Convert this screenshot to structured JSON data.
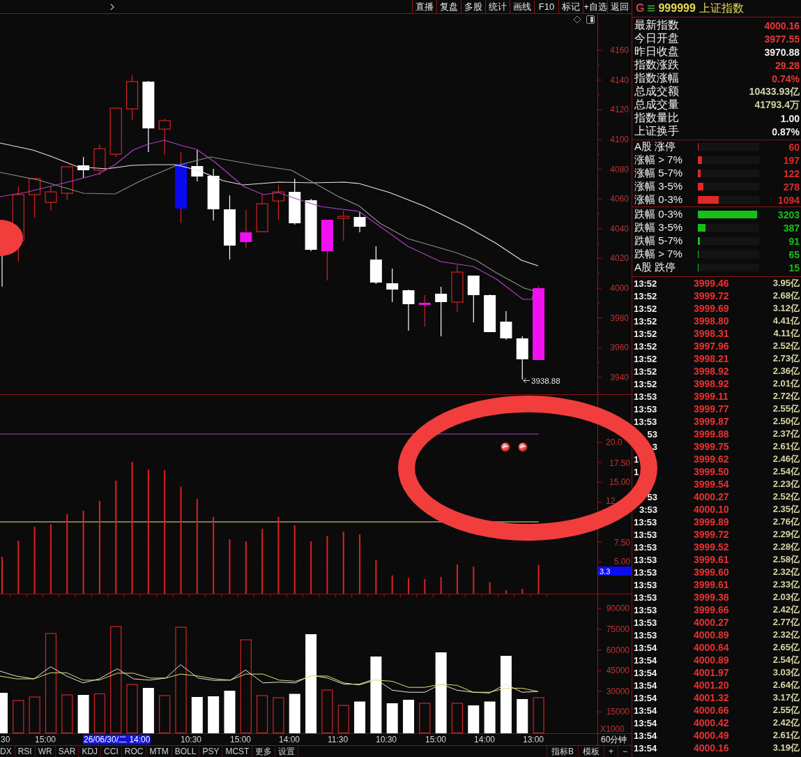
{
  "toolbar": {
    "buttons": [
      "直播",
      "复盘",
      "多股",
      "统计",
      "画线",
      "F10",
      "标记",
      "+自选",
      "返回"
    ]
  },
  "price_chart": {
    "axis_labels": [
      "4160",
      "4140",
      "4120",
      "4100",
      "4080",
      "4060",
      "4040",
      "4020",
      "4000",
      "3980",
      "3960",
      "3940"
    ],
    "low_label": "3938.88"
  },
  "indicator_chart": {
    "axis_labels": [
      {
        "text": "20.0",
        "right_hidden": true
      },
      {
        "text": "17.50"
      },
      {
        "text": "15.00"
      },
      {
        "text": "12",
        "right_hidden": true
      },
      {
        "text": "7.50"
      },
      {
        "text": "5.00"
      }
    ],
    "current_value": "3.3"
  },
  "volume_chart": {
    "axis_labels": [
      "90000",
      "75000",
      "60000",
      "45000",
      "30000",
      "15000"
    ],
    "unit": "X1000"
  },
  "time_axis": {
    "labels": [
      {
        "text": "30",
        "highlighted": false
      },
      {
        "text": "15:00",
        "highlighted": false
      },
      {
        "text": "26/06/30/二 14:00",
        "highlighted": true
      },
      {
        "text": "10:30",
        "highlighted": false
      },
      {
        "text": "15:00",
        "highlighted": false
      },
      {
        "text": "14:00",
        "highlighted": false
      },
      {
        "text": "11:30",
        "highlighted": false
      },
      {
        "text": "10:30",
        "highlighted": false
      },
      {
        "text": "15:00",
        "highlighted": false
      },
      {
        "text": "14:00",
        "highlighted": false
      },
      {
        "text": "13:00",
        "highlighted": false
      }
    ],
    "period": "60分钟"
  },
  "indicator_tabs": [
    {
      "label": "DX",
      "selected": false
    },
    {
      "label": "RSI",
      "selected": false
    },
    {
      "label": "WR",
      "selected": false
    },
    {
      "label": "SAR",
      "selected": false
    },
    {
      "label": "KDJ",
      "selected": false
    },
    {
      "label": "CCI",
      "selected": false
    },
    {
      "label": "ROC",
      "selected": false
    },
    {
      "label": "MTM",
      "selected": false
    },
    {
      "label": "BOLL",
      "selected": false
    },
    {
      "label": "PSY",
      "selected": false
    },
    {
      "label": "MCST",
      "selected": false
    },
    {
      "label": "更多",
      "selected": false
    },
    {
      "label": "设置",
      "selected": false
    }
  ],
  "tool_buttons": [
    "指标B",
    "模板",
    "+",
    "−"
  ],
  "quote": {
    "flag": "G",
    "code": "999999",
    "name": "上证指数"
  },
  "stats": [
    {
      "label": "最新指数",
      "value": "4000.16",
      "color": "#f03434"
    },
    {
      "label": "今日开盘",
      "value": "3977.55",
      "color": "#f03434"
    },
    {
      "label": "昨日收盘",
      "value": "3970.88",
      "color": "#f0f0f0"
    },
    {
      "label": "指数涨跌",
      "value": "29.28",
      "color": "#f03434"
    },
    {
      "label": "指数涨幅",
      "value": "0.74%",
      "color": "#f03434"
    },
    {
      "label": "总成交额",
      "value": "10433.93亿",
      "color": "#d2d2aa"
    },
    {
      "label": "总成交量",
      "value": "41793.4万",
      "color": "#c4d49a"
    },
    {
      "label": "指数量比",
      "value": "1.00",
      "color": "#f0f0f0"
    },
    {
      "label": "上证换手",
      "value": "0.87%",
      "color": "#f0f0f0"
    }
  ],
  "breadth": {
    "rising": [
      {
        "label": "A股 涨停",
        "value": "60",
        "level": 0.011,
        "color": "#e02828"
      },
      {
        "label": "涨幅 > 7%",
        "value": "197",
        "level": 0.068,
        "color": "#e02828"
      },
      {
        "label": "涨幅 5-7%",
        "value": "122",
        "level": 0.045,
        "color": "#e02828"
      },
      {
        "label": "涨幅 3-5%",
        "value": "278",
        "level": 0.091,
        "color": "#e02828"
      },
      {
        "label": "涨幅 0-3%",
        "value": "1094",
        "level": 0.341,
        "color": "#e02828"
      }
    ],
    "falling": [
      {
        "label": "跌幅 0-3%",
        "value": "3203",
        "level": 0.966,
        "color": "#18c018"
      },
      {
        "label": "跌幅 3-5%",
        "value": "387",
        "level": 0.125,
        "color": "#18c018"
      },
      {
        "label": "跌幅 5-7%",
        "value": "91",
        "level": 0.034,
        "color": "#18c018"
      },
      {
        "label": "跌幅 > 7%",
        "value": "65",
        "level": 0.011,
        "color": "#18c018"
      },
      {
        "label": "A股 跌停",
        "value": "15",
        "level": 0.011,
        "color": "#18c018"
      }
    ]
  },
  "trades": [
    {
      "time": "13:52",
      "left_hidden": false,
      "price": "3999.46",
      "amount": "3.95亿"
    },
    {
      "time": "13:52",
      "left_hidden": false,
      "price": "3999.72",
      "amount": "2.68亿"
    },
    {
      "time": "13:52",
      "left_hidden": false,
      "price": "3999.69",
      "amount": "3.12亿"
    },
    {
      "time": "13:52",
      "left_hidden": false,
      "price": "3998.80",
      "amount": "4.41亿"
    },
    {
      "time": "13:52",
      "left_hidden": false,
      "price": "3998.31",
      "amount": "4.11亿"
    },
    {
      "time": "13:52",
      "left_hidden": false,
      "price": "3997.96",
      "amount": "2.52亿"
    },
    {
      "time": "13:52",
      "left_hidden": false,
      "price": "3998.21",
      "amount": "2.73亿"
    },
    {
      "time": "13:52",
      "left_hidden": false,
      "price": "3998.92",
      "amount": "2.36亿"
    },
    {
      "time": "13:52",
      "left_hidden": false,
      "price": "3998.92",
      "amount": "2.01亿"
    },
    {
      "time": "13:53",
      "left_hidden": false,
      "price": "3999.11",
      "amount": "2.72亿"
    },
    {
      "time": "13:53",
      "left_hidden": false,
      "price": "3999.77",
      "amount": "2.55亿"
    },
    {
      "time": "13:53",
      "left_hidden": false,
      "price": "3999.87",
      "amount": "2.50亿"
    },
    {
      "time": "53",
      "left_hidden": true,
      "price": "3999.88",
      "amount": "2.37亿"
    },
    {
      "time": "3",
      "left_hidden": true,
      "price": "3999.75",
      "amount": "2.61亿"
    },
    {
      "time": "1",
      "left_hidden": false,
      "price": "3999.62",
      "amount": "2.46亿"
    },
    {
      "time": "1",
      "left_hidden": false,
      "price": "3999.50",
      "amount": "2.54亿"
    },
    {
      "price": "3999.54",
      "amount": "2.23亿"
    },
    {
      "time": "53",
      "left_hidden": true,
      "price": "4000.27",
      "amount": "2.52亿"
    },
    {
      "time": "3:53",
      "left_hidden": true,
      "price": "4000.10",
      "amount": "2.35亿"
    },
    {
      "time": "13:53",
      "left_hidden": false,
      "price": "3999.89",
      "amount": "2.76亿"
    },
    {
      "time": "13:53",
      "left_hidden": false,
      "price": "3999.72",
      "amount": "2.29亿"
    },
    {
      "time": "13:53",
      "left_hidden": false,
      "price": "3999.52",
      "amount": "2.28亿"
    },
    {
      "time": "13:53",
      "left_hidden": false,
      "price": "3999.61",
      "amount": "2.58亿"
    },
    {
      "time": "13:53",
      "left_hidden": false,
      "price": "3999.60",
      "amount": "2.32亿"
    },
    {
      "time": "13:53",
      "left_hidden": false,
      "price": "3999.61",
      "amount": "2.33亿"
    },
    {
      "time": "13:53",
      "left_hidden": false,
      "price": "3999.38",
      "amount": "2.03亿"
    },
    {
      "time": "13:53",
      "left_hidden": false,
      "price": "3999.66",
      "amount": "2.42亿"
    },
    {
      "time": "13:53",
      "left_hidden": false,
      "price": "4000.27",
      "amount": "2.77亿"
    },
    {
      "time": "13:53",
      "left_hidden": false,
      "price": "4000.89",
      "amount": "2.32亿"
    },
    {
      "time": "13:54",
      "left_hidden": false,
      "price": "4000.64",
      "amount": "2.65亿"
    },
    {
      "time": "13:54",
      "left_hidden": false,
      "price": "4000.89",
      "amount": "2.54亿"
    },
    {
      "time": "13:54",
      "left_hidden": false,
      "price": "4001.97",
      "amount": "3.03亿"
    },
    {
      "time": "13:54",
      "left_hidden": false,
      "price": "4001.20",
      "amount": "2.64亿"
    },
    {
      "time": "13:54",
      "left_hidden": false,
      "price": "4001.32",
      "amount": "3.17亿"
    },
    {
      "time": "13:54",
      "left_hidden": false,
      "price": "4000.66",
      "amount": "2.55亿"
    },
    {
      "time": "13:54",
      "left_hidden": false,
      "price": "4000.42",
      "amount": "2.42亿"
    },
    {
      "time": "13:54",
      "left_hidden": false,
      "price": "4000.49",
      "amount": "2.61亿"
    },
    {
      "time": "13:54",
      "left_hidden": false,
      "price": "4000.16",
      "amount": "3.19亿"
    }
  ]
}
